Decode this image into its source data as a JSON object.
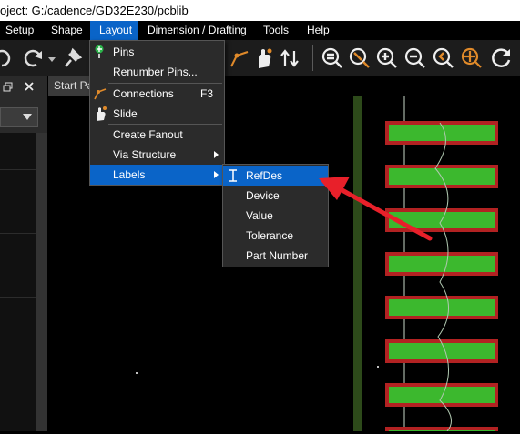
{
  "title": "oject: G:/cadence/GD32E230/pcblib",
  "menubar": {
    "items": [
      "Setup",
      "Shape",
      "Layout",
      "Dimension / Drafting",
      "Tools",
      "Help"
    ]
  },
  "tab": {
    "label": "Start Pa"
  },
  "layout_menu": {
    "items": [
      {
        "label": "Pins",
        "accel": "",
        "submenu": false
      },
      {
        "label": "Renumber Pins...",
        "accel": "",
        "submenu": false
      },
      {
        "label": "Connections",
        "accel": "F3",
        "submenu": false
      },
      {
        "label": "Slide",
        "accel": "",
        "submenu": false
      },
      {
        "label": "Create Fanout",
        "accel": "",
        "submenu": false
      },
      {
        "label": "Via Structure",
        "accel": "",
        "submenu": true
      },
      {
        "label": "Labels",
        "accel": "",
        "submenu": true
      }
    ]
  },
  "labels_submenu": {
    "items": [
      "RefDes",
      "Device",
      "Value",
      "Tolerance",
      "Part Number"
    ]
  },
  "colors": {
    "accent": "#0a64c8",
    "pad": "#3cb82e",
    "pad_border": "#b22222",
    "arrow": "#e8202a"
  }
}
